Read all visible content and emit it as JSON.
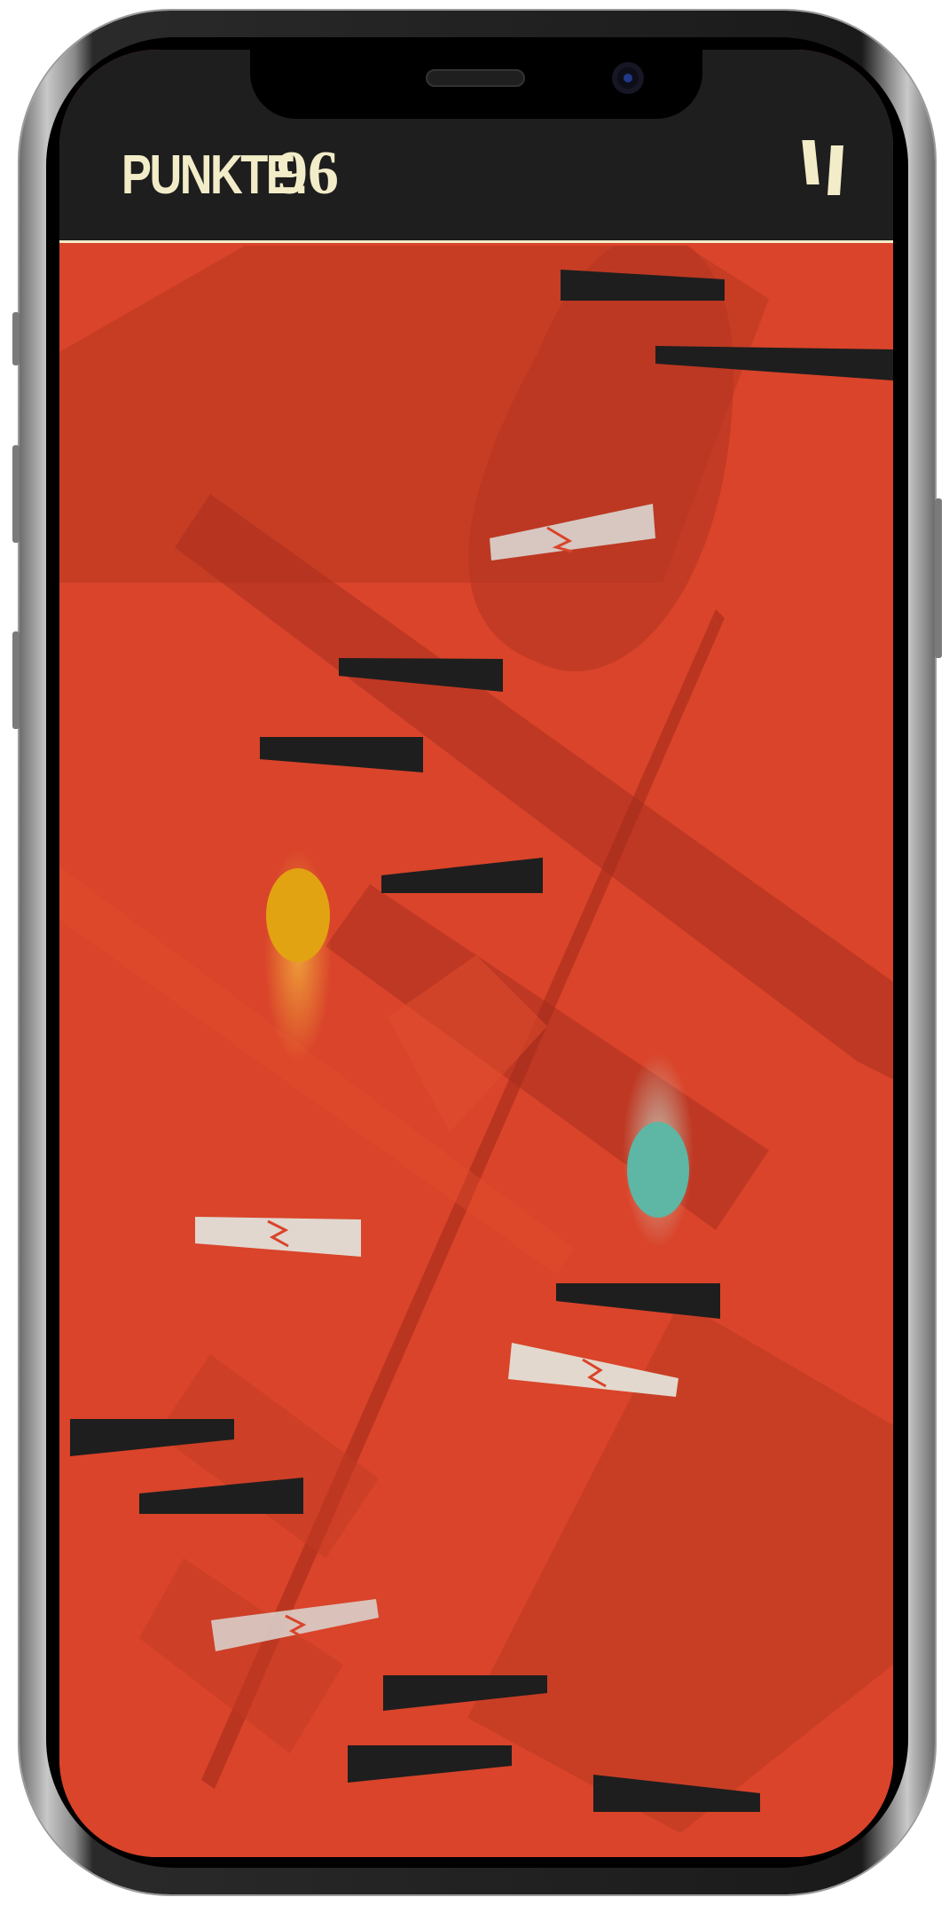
{
  "hud": {
    "score_label": "PUNKTE:",
    "score_value": "96"
  },
  "icons": {
    "pause": "pause-icon",
    "glow": "glow-trail"
  },
  "colors": {
    "background": "#d9442a",
    "hud_background": "#1e1e1e",
    "hud_text": "#f2ecc8",
    "solid_platform": "#1e1e1e",
    "fragile_platform": "#d9d7d2",
    "crack": "#d9442a",
    "yellow_ball": "#e2a312",
    "teal_ball": "#5eb6a4"
  },
  "game": {
    "balls": [
      {
        "name": "yellow-ball",
        "color": "#e2a312"
      },
      {
        "name": "teal-ball",
        "color": "#5eb6a4"
      }
    ],
    "platforms": [
      {
        "type": "solid"
      },
      {
        "type": "solid"
      },
      {
        "type": "fragile"
      },
      {
        "type": "solid"
      },
      {
        "type": "solid"
      },
      {
        "type": "solid"
      },
      {
        "type": "fragile"
      },
      {
        "type": "solid"
      },
      {
        "type": "fragile"
      },
      {
        "type": "solid"
      },
      {
        "type": "solid"
      },
      {
        "type": "solid"
      },
      {
        "type": "fragile"
      },
      {
        "type": "solid"
      },
      {
        "type": "solid"
      },
      {
        "type": "solid"
      }
    ]
  }
}
